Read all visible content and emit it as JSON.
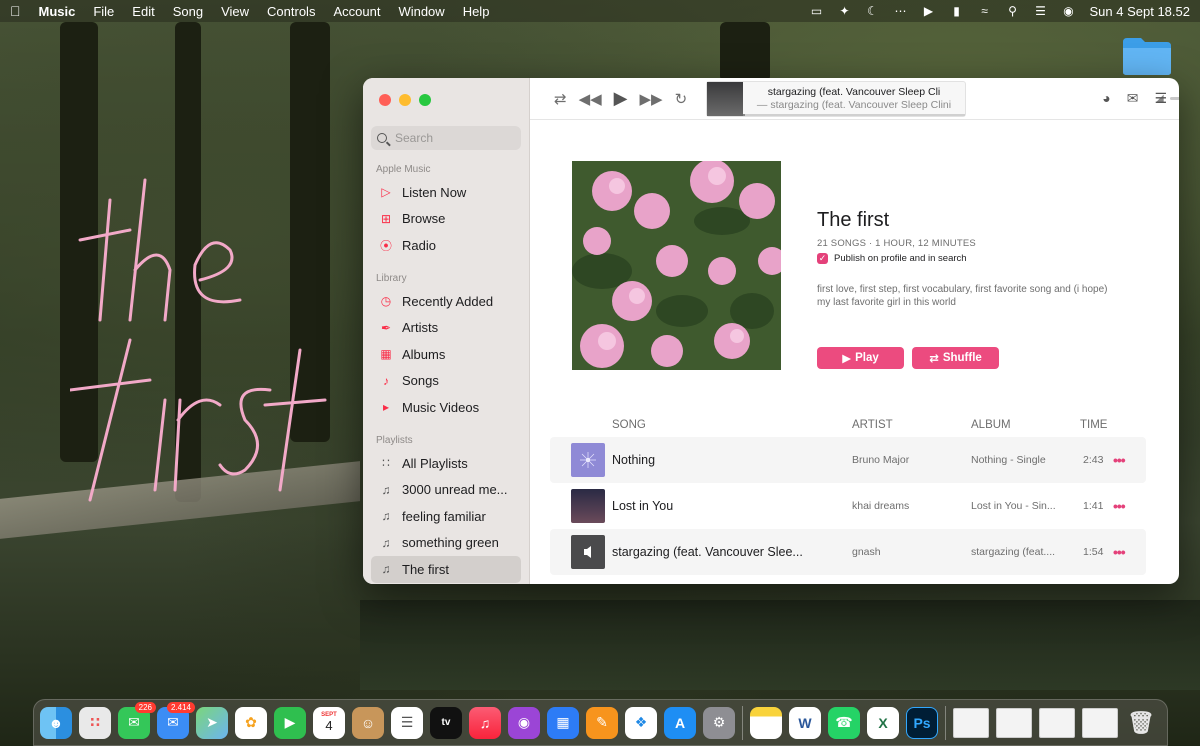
{
  "menubar": {
    "app_name": "Music",
    "items": [
      "File",
      "Edit",
      "Song",
      "View",
      "Controls",
      "Account",
      "Window",
      "Help"
    ],
    "datetime": "Sun 4 Sept  18.52"
  },
  "sidebar": {
    "search_placeholder": "Search",
    "sections": {
      "apple_music": "Apple Music",
      "library": "Library",
      "playlists": "Playlists"
    },
    "apple_music_items": [
      "Listen Now",
      "Browse",
      "Radio"
    ],
    "library_items": [
      "Recently Added",
      "Artists",
      "Albums",
      "Songs",
      "Music Videos"
    ],
    "playlist_items": [
      "All Playlists",
      "3000 unread me...",
      "feeling familiar",
      "something green",
      "The first"
    ],
    "selected": "The first"
  },
  "now_playing": {
    "title": "stargazing (feat. Vancouver Sleep Cli",
    "subtitle": "— stargazing (feat. Vancouver Sleep Clini",
    "progress": 0.01,
    "volume": 0.85
  },
  "playlist": {
    "title": "The first",
    "meta": "21 SONGS · 1 HOUR, 12 MINUTES",
    "publish_label": "Publish on profile and in search",
    "publish_checked": true,
    "description": "first love, first step, first vocabulary, first favorite song and (i hope) my last favorite girl in this world",
    "play_label": "Play",
    "shuffle_label": "Shuffle"
  },
  "table": {
    "headers": [
      "SONG",
      "ARTIST",
      "ALBUM",
      "TIME"
    ],
    "rows": [
      {
        "title": "Nothing",
        "artist": "Bruno Major",
        "album": "Nothing - Single",
        "time": "2:43"
      },
      {
        "title": "Lost in You",
        "artist": "khai dreams",
        "album": "Lost in You - Sin...",
        "time": "1:41"
      },
      {
        "title": "stargazing (feat. Vancouver Slee...",
        "artist": "gnash",
        "album": "stargazing (feat....",
        "time": "1:54"
      }
    ]
  },
  "dock": {
    "messages_badge": "226",
    "mail_badge": "2.414",
    "calendar_month": "SEPT",
    "calendar_day": "4"
  },
  "colors": {
    "accent": "#ec4b7f",
    "sidebar_icon": "#fa2d48"
  }
}
